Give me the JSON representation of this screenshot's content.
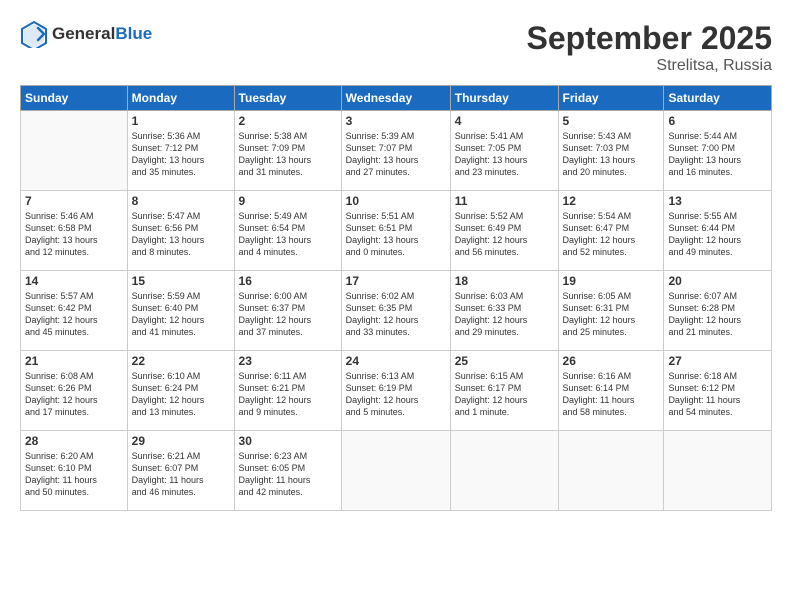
{
  "header": {
    "logo_line1": "General",
    "logo_line2": "Blue",
    "month": "September 2025",
    "location": "Strelitsa, Russia"
  },
  "weekdays": [
    "Sunday",
    "Monday",
    "Tuesday",
    "Wednesday",
    "Thursday",
    "Friday",
    "Saturday"
  ],
  "weeks": [
    [
      {
        "day": "",
        "info": ""
      },
      {
        "day": "1",
        "info": "Sunrise: 5:36 AM\nSunset: 7:12 PM\nDaylight: 13 hours\nand 35 minutes."
      },
      {
        "day": "2",
        "info": "Sunrise: 5:38 AM\nSunset: 7:09 PM\nDaylight: 13 hours\nand 31 minutes."
      },
      {
        "day": "3",
        "info": "Sunrise: 5:39 AM\nSunset: 7:07 PM\nDaylight: 13 hours\nand 27 minutes."
      },
      {
        "day": "4",
        "info": "Sunrise: 5:41 AM\nSunset: 7:05 PM\nDaylight: 13 hours\nand 23 minutes."
      },
      {
        "day": "5",
        "info": "Sunrise: 5:43 AM\nSunset: 7:03 PM\nDaylight: 13 hours\nand 20 minutes."
      },
      {
        "day": "6",
        "info": "Sunrise: 5:44 AM\nSunset: 7:00 PM\nDaylight: 13 hours\nand 16 minutes."
      }
    ],
    [
      {
        "day": "7",
        "info": "Sunrise: 5:46 AM\nSunset: 6:58 PM\nDaylight: 13 hours\nand 12 minutes."
      },
      {
        "day": "8",
        "info": "Sunrise: 5:47 AM\nSunset: 6:56 PM\nDaylight: 13 hours\nand 8 minutes."
      },
      {
        "day": "9",
        "info": "Sunrise: 5:49 AM\nSunset: 6:54 PM\nDaylight: 13 hours\nand 4 minutes."
      },
      {
        "day": "10",
        "info": "Sunrise: 5:51 AM\nSunset: 6:51 PM\nDaylight: 13 hours\nand 0 minutes."
      },
      {
        "day": "11",
        "info": "Sunrise: 5:52 AM\nSunset: 6:49 PM\nDaylight: 12 hours\nand 56 minutes."
      },
      {
        "day": "12",
        "info": "Sunrise: 5:54 AM\nSunset: 6:47 PM\nDaylight: 12 hours\nand 52 minutes."
      },
      {
        "day": "13",
        "info": "Sunrise: 5:55 AM\nSunset: 6:44 PM\nDaylight: 12 hours\nand 49 minutes."
      }
    ],
    [
      {
        "day": "14",
        "info": "Sunrise: 5:57 AM\nSunset: 6:42 PM\nDaylight: 12 hours\nand 45 minutes."
      },
      {
        "day": "15",
        "info": "Sunrise: 5:59 AM\nSunset: 6:40 PM\nDaylight: 12 hours\nand 41 minutes."
      },
      {
        "day": "16",
        "info": "Sunrise: 6:00 AM\nSunset: 6:37 PM\nDaylight: 12 hours\nand 37 minutes."
      },
      {
        "day": "17",
        "info": "Sunrise: 6:02 AM\nSunset: 6:35 PM\nDaylight: 12 hours\nand 33 minutes."
      },
      {
        "day": "18",
        "info": "Sunrise: 6:03 AM\nSunset: 6:33 PM\nDaylight: 12 hours\nand 29 minutes."
      },
      {
        "day": "19",
        "info": "Sunrise: 6:05 AM\nSunset: 6:31 PM\nDaylight: 12 hours\nand 25 minutes."
      },
      {
        "day": "20",
        "info": "Sunrise: 6:07 AM\nSunset: 6:28 PM\nDaylight: 12 hours\nand 21 minutes."
      }
    ],
    [
      {
        "day": "21",
        "info": "Sunrise: 6:08 AM\nSunset: 6:26 PM\nDaylight: 12 hours\nand 17 minutes."
      },
      {
        "day": "22",
        "info": "Sunrise: 6:10 AM\nSunset: 6:24 PM\nDaylight: 12 hours\nand 13 minutes."
      },
      {
        "day": "23",
        "info": "Sunrise: 6:11 AM\nSunset: 6:21 PM\nDaylight: 12 hours\nand 9 minutes."
      },
      {
        "day": "24",
        "info": "Sunrise: 6:13 AM\nSunset: 6:19 PM\nDaylight: 12 hours\nand 5 minutes."
      },
      {
        "day": "25",
        "info": "Sunrise: 6:15 AM\nSunset: 6:17 PM\nDaylight: 12 hours\nand 1 minute."
      },
      {
        "day": "26",
        "info": "Sunrise: 6:16 AM\nSunset: 6:14 PM\nDaylight: 11 hours\nand 58 minutes."
      },
      {
        "day": "27",
        "info": "Sunrise: 6:18 AM\nSunset: 6:12 PM\nDaylight: 11 hours\nand 54 minutes."
      }
    ],
    [
      {
        "day": "28",
        "info": "Sunrise: 6:20 AM\nSunset: 6:10 PM\nDaylight: 11 hours\nand 50 minutes."
      },
      {
        "day": "29",
        "info": "Sunrise: 6:21 AM\nSunset: 6:07 PM\nDaylight: 11 hours\nand 46 minutes."
      },
      {
        "day": "30",
        "info": "Sunrise: 6:23 AM\nSunset: 6:05 PM\nDaylight: 11 hours\nand 42 minutes."
      },
      {
        "day": "",
        "info": ""
      },
      {
        "day": "",
        "info": ""
      },
      {
        "day": "",
        "info": ""
      },
      {
        "day": "",
        "info": ""
      }
    ]
  ]
}
